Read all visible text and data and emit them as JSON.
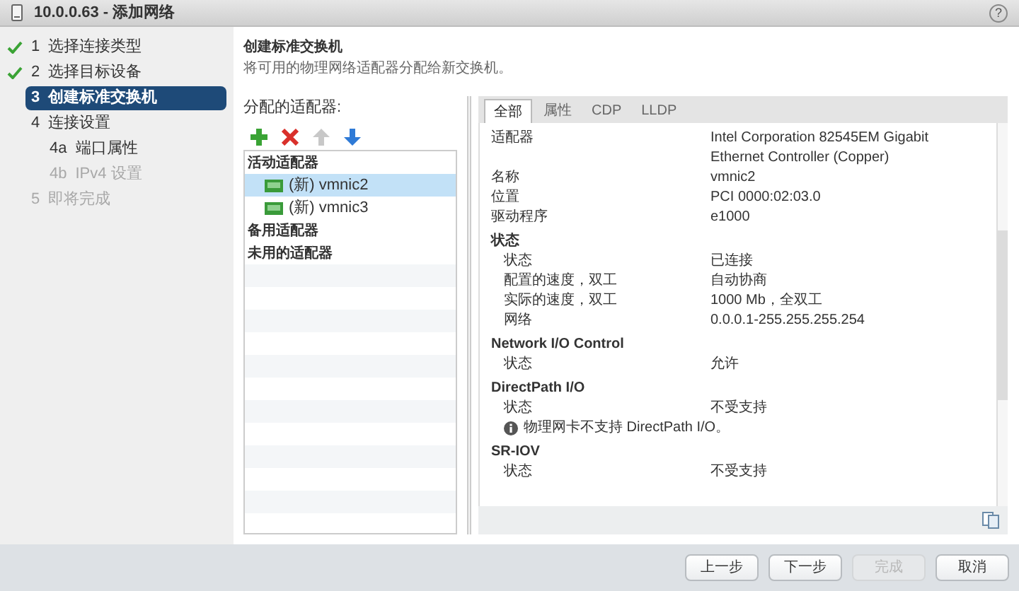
{
  "window": {
    "title": "10.0.0.63 - 添加网络",
    "help": "?"
  },
  "steps": [
    {
      "number": "1",
      "label": "选择连接类型",
      "completed": true,
      "selected": false,
      "disabled": false
    },
    {
      "number": "2",
      "label": "选择目标设备",
      "completed": true,
      "selected": false,
      "disabled": false
    },
    {
      "number": "3",
      "label": "创建标准交换机",
      "completed": false,
      "selected": true,
      "disabled": false
    },
    {
      "number": "4",
      "label": "连接设置",
      "completed": false,
      "selected": false,
      "disabled": false,
      "children": [
        {
          "number": "4a",
          "label": "端口属性",
          "selected": false,
          "disabled": false
        },
        {
          "number": "4b",
          "label": "IPv4 设置",
          "selected": false,
          "disabled": true
        }
      ]
    },
    {
      "number": "5",
      "label": "即将完成",
      "completed": false,
      "selected": false,
      "disabled": true
    }
  ],
  "header": {
    "title": "创建标准交换机",
    "description": "将可用的物理网络适配器分配给新交换机。"
  },
  "adapters": {
    "label": "分配的适配器:",
    "tools": [
      {
        "kind": "add",
        "disabled": false
      },
      {
        "kind": "remove",
        "disabled": false
      },
      {
        "kind": "up",
        "disabled": true
      },
      {
        "kind": "down",
        "disabled": false
      }
    ],
    "groups": [
      {
        "name": "活动适配器",
        "items": [
          {
            "name": "(新) vmnic2",
            "selected": true
          },
          {
            "name": "(新) vmnic3",
            "selected": false
          }
        ]
      },
      {
        "name": "备用适配器"
      },
      {
        "name": "未用的适配器"
      }
    ]
  },
  "details": {
    "tabs": [
      {
        "label": "全部",
        "selected": true
      },
      {
        "label": "属性",
        "selected": false
      },
      {
        "label": "CDP",
        "selected": false
      },
      {
        "label": "LLDP",
        "selected": false
      }
    ],
    "rows": [
      {
        "kind": "row",
        "label": "适配器",
        "value": "Intel Corporation 82545EM Gigabit Ethernet Controller (Copper)"
      },
      {
        "kind": "row",
        "label": "名称",
        "value": "vmnic2"
      },
      {
        "kind": "row",
        "label": "位置",
        "value": "PCI 0000:02:03.0"
      },
      {
        "kind": "row",
        "label": "驱动程序",
        "value": "e1000"
      },
      {
        "kind": "section",
        "label": "状态"
      },
      {
        "kind": "subrow",
        "label": "状态",
        "value": "已连接"
      },
      {
        "kind": "subrow",
        "label": "配置的速度，双工",
        "value": "自动协商"
      },
      {
        "kind": "subrow",
        "label": "实际的速度，双工",
        "value": "1000 Mb，全双工"
      },
      {
        "kind": "subrow",
        "label": "网络",
        "value": "0.0.0.1-255.255.255.254"
      },
      {
        "kind": "section",
        "label": "Network I/O Control"
      },
      {
        "kind": "subrow",
        "label": "状态",
        "value": "允许"
      },
      {
        "kind": "section",
        "label": "DirectPath I/O"
      },
      {
        "kind": "subrow",
        "label": "状态",
        "value": "不受支持"
      },
      {
        "kind": "note",
        "label": "物理网卡不支持 DirectPath I/O。"
      },
      {
        "kind": "section",
        "label": "SR-IOV"
      },
      {
        "kind": "subrow",
        "label": "状态",
        "value": "不受支持"
      }
    ]
  },
  "buttons": [
    {
      "label": "上一步",
      "disabled": false
    },
    {
      "label": "下一步",
      "disabled": false
    },
    {
      "label": "完成",
      "disabled": true
    },
    {
      "label": "取消",
      "disabled": false
    }
  ]
}
